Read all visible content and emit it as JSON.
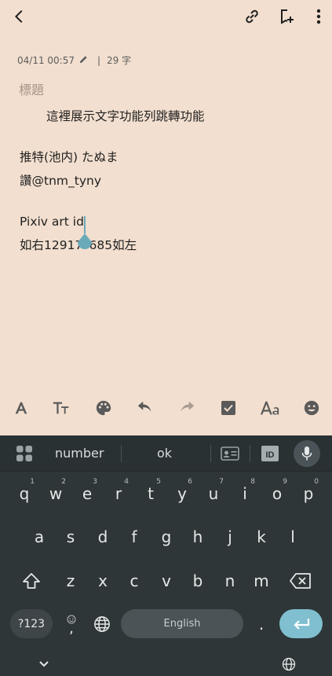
{
  "meta": {
    "datetime": "04/11 00:57",
    "char_count": "29 字"
  },
  "note": {
    "title_placeholder": "標題",
    "lines": [
      "這裡展示文字功能列跳轉功能",
      "推特(池内) たぬま",
      "讚@tnm_tyny",
      "Pixiv art id",
      "如右12917?685如左"
    ]
  },
  "keyboard": {
    "suggestions": [
      "number",
      "ok"
    ],
    "row1": [
      {
        "k": "q",
        "n": "1"
      },
      {
        "k": "w",
        "n": "2"
      },
      {
        "k": "e",
        "n": "3"
      },
      {
        "k": "r",
        "n": "4"
      },
      {
        "k": "t",
        "n": "5"
      },
      {
        "k": "y",
        "n": "6"
      },
      {
        "k": "u",
        "n": "7"
      },
      {
        "k": "i",
        "n": "8"
      },
      {
        "k": "o",
        "n": "9"
      },
      {
        "k": "p",
        "n": "0"
      }
    ],
    "row2": [
      "a",
      "s",
      "d",
      "f",
      "g",
      "h",
      "j",
      "k",
      "l"
    ],
    "row3": [
      "z",
      "x",
      "c",
      "v",
      "b",
      "n",
      "m"
    ],
    "symbols_label": "?123",
    "comma_label": ",",
    "space_label": "English",
    "period_label": "."
  },
  "colors": {
    "note_bg": "#f2dfcf",
    "keyboard_bg": "#2f3638",
    "accent": "#7fbfcf"
  }
}
